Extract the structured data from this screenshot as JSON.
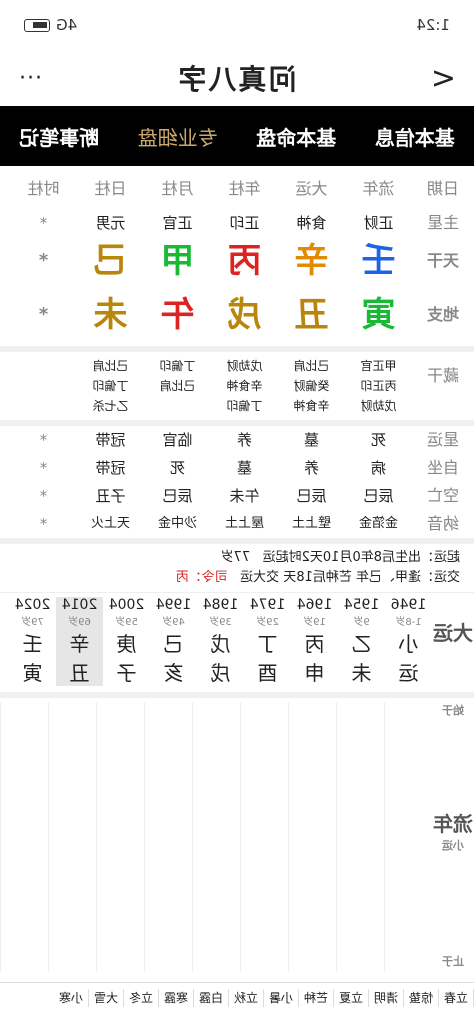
{
  "status": {
    "time": "1:24",
    "net": "4G",
    "battery": "HD"
  },
  "title": {
    "text": "问真八字",
    "back": "<",
    "more": "···"
  },
  "tabs": [
    "基本信息",
    "基本命盘",
    "专业细盘",
    "断事笔记"
  ],
  "header": [
    "日期",
    "流年",
    "大运",
    "年柱",
    "月柱",
    "日柱",
    "时柱"
  ],
  "zhuxing": {
    "label": "主星",
    "values": [
      "正财",
      "食神",
      "正印",
      "正官",
      "元男",
      "*"
    ]
  },
  "tiangan": {
    "label": "天干",
    "values": [
      "壬",
      "辛",
      "丙",
      "甲",
      "己",
      "*"
    ]
  },
  "dizhi": {
    "label": "地支",
    "values": [
      "寅",
      "丑",
      "戌",
      "午",
      "未",
      "*"
    ]
  },
  "canggan": {
    "label": "藏干",
    "cols": [
      [
        "甲正官",
        "丙正印",
        "戊劫财"
      ],
      [
        "己比肩",
        "癸偏财",
        "辛食神"
      ],
      [
        "戊劫财",
        "辛食神",
        "丁偏印"
      ],
      [
        "丁偏印",
        "己比肩",
        ""
      ],
      [
        "己比肩",
        "丁偏印",
        "乙七杀"
      ]
    ]
  },
  "xingyun": {
    "label": "星运",
    "values": [
      "死",
      "墓",
      "养",
      "临官",
      "冠带",
      "*"
    ]
  },
  "zizuo": {
    "label": "自坐",
    "values": [
      "病",
      "养",
      "墓",
      "死",
      "冠带",
      "*"
    ]
  },
  "kongwang": {
    "label": "空亡",
    "values": [
      "辰巳",
      "辰巳",
      "午未",
      "辰巳",
      "子丑",
      "*"
    ]
  },
  "nayin": {
    "label": "纳音",
    "values": [
      "金箔金",
      "壁上土",
      "屋上土",
      "沙中金",
      "天上火",
      "*"
    ]
  },
  "qiyun": {
    "label": "起运",
    "text": "出生后8年0月10天2时起运",
    "label2": "交运",
    "text2": "逢甲、己年 芒种后18天 交大运",
    "age": "77岁",
    "siling": "司令：丙"
  },
  "dayun": {
    "label": "大运",
    "years": [
      "1946",
      "1954",
      "1964",
      "1974",
      "1984",
      "1994",
      "2004",
      "2014",
      "2024"
    ],
    "ages": [
      "1-8岁",
      "9岁",
      "19岁",
      "29岁",
      "39岁",
      "49岁",
      "59岁",
      "69岁",
      "79岁"
    ],
    "gan": [
      "小",
      "乙",
      "丙",
      "丁",
      "戊",
      "己",
      "庚",
      "辛",
      "壬"
    ],
    "zhi": [
      "运",
      "未",
      "申",
      "酉",
      "戌",
      "亥",
      "子",
      "丑",
      "寅"
    ]
  },
  "liunian": {
    "label": "流年",
    "sub": "小运",
    "start": "始于",
    "end": "止于"
  },
  "jieqi": [
    "立春",
    "惊蛰",
    "清明",
    "立夏",
    "芒种",
    "小暑",
    "立秋",
    "白露",
    "寒露",
    "立冬",
    "大雪",
    "小寒"
  ]
}
